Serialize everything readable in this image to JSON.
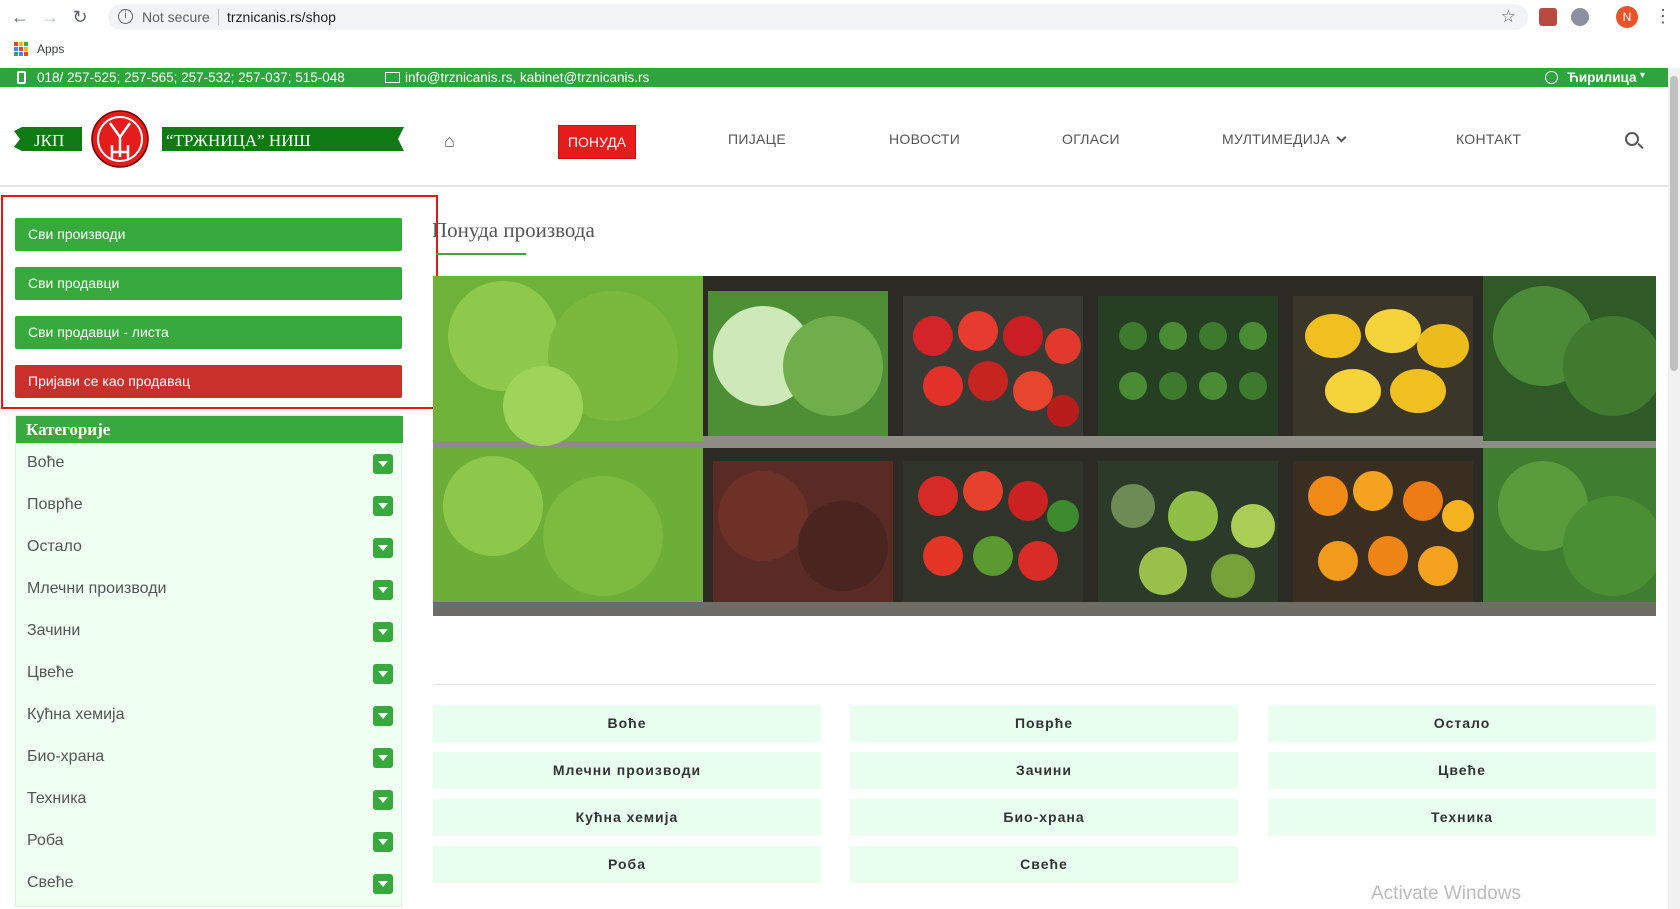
{
  "browser": {
    "security_label": "Not secure",
    "url": "trznicanis.rs/shop",
    "bookmarks_apps": "Apps",
    "profile_initial": "N"
  },
  "topbar": {
    "phone": "018/ 257-525; 257-565; 257-532; 257-037; 515-048",
    "email": "info@trznicanis.rs, kabinet@trznicanis.rs",
    "language": "Ћирилица",
    "language_caret": "▾"
  },
  "logo": {
    "left_text": "ЈКП",
    "right_text": "“ТРЖНИЦА” НИШ"
  },
  "nav": {
    "items": [
      "ПОНУДА",
      "ПИЈАЦЕ",
      "НОВОСТИ",
      "ОГЛАСИ",
      "МУЛТИМЕДИЈА",
      "КОНТАКТ"
    ],
    "active_index": 0
  },
  "sidebar": {
    "buttons": [
      "Сви производи",
      "Сви продавци",
      "Сви продавци - листа",
      "Пријави се као продавац"
    ],
    "categories_title": "Категорије",
    "categories": [
      "Воће",
      "Поврће",
      "Остало",
      "Млечни производи",
      "Зачини",
      "Цвеће",
      "Кућна хемија",
      "Био-храна",
      "Техника",
      "Роба",
      "Свеће"
    ]
  },
  "main": {
    "title": "Понуда производа",
    "tiles": [
      "Воће",
      "Поврће",
      "Остало",
      "Млечни производи",
      "Зачини",
      "Цвеће",
      "Кућна хемија",
      "Био-храна",
      "Техника",
      "Роба",
      "Свеће"
    ]
  },
  "watermark": "Activate Windows",
  "colors": {
    "brand_green": "#38a93d",
    "topbar_green": "#2ea43c",
    "nav_active_red": "#e51c1c",
    "seller_button_red": "#c9302c",
    "highlight_red": "#e8151b",
    "tile_bg": "#e9fff0"
  }
}
